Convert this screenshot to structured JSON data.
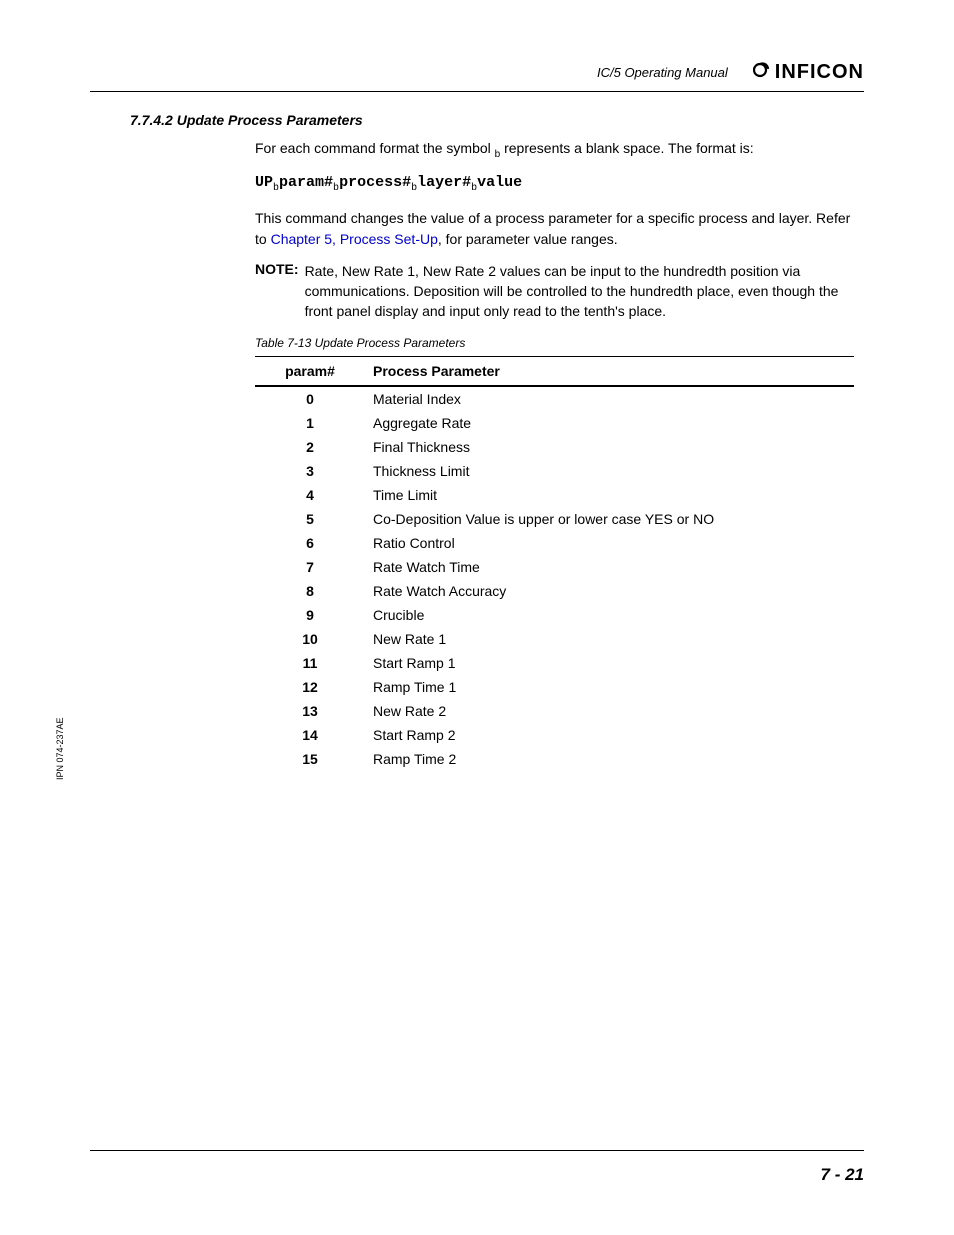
{
  "header": {
    "manual_title": "IC/5 Operating Manual",
    "logo_text": "INFICON"
  },
  "section": {
    "number_title": "7.7.4.2  Update Process Parameters"
  },
  "body": {
    "intro_line1": "For each command format the symbol ",
    "intro_sub": "b",
    "intro_line2": " represents a blank space. The format is:",
    "cmd": {
      "p1": "UP",
      "s1": "b",
      "p2": "param#",
      "s2": "b",
      "p3": "process#",
      "s3": "b",
      "p4": "layer#",
      "s4": "b",
      "p5": "value"
    },
    "desc_pre": "This command changes the value of a process parameter for a specific process and layer. Refer to ",
    "desc_link": "Chapter 5, Process Set-Up",
    "desc_post": ", for parameter value ranges.",
    "note_label": "NOTE:",
    "note_body": "Rate, New Rate 1, New Rate 2 values can be input to the hundredth position via communications. Deposition will be controlled to the hundredth place, even though the front panel display and input only read to the tenth's place."
  },
  "table": {
    "caption": "Table 7-13  Update Process Parameters",
    "col1": "param#",
    "col2": "Process Parameter",
    "rows": [
      {
        "n": "0",
        "p": "Material Index"
      },
      {
        "n": "1",
        "p": "Aggregate Rate"
      },
      {
        "n": "2",
        "p": "Final Thickness"
      },
      {
        "n": "3",
        "p": "Thickness Limit"
      },
      {
        "n": "4",
        "p": "Time Limit"
      },
      {
        "n": "5",
        "p": "Co-Deposition   Value is upper or lower case YES or NO"
      },
      {
        "n": "6",
        "p": "Ratio Control"
      },
      {
        "n": "7",
        "p": "Rate Watch Time"
      },
      {
        "n": "8",
        "p": "Rate Watch Accuracy"
      },
      {
        "n": "9",
        "p": "Crucible"
      },
      {
        "n": "10",
        "p": "New Rate 1"
      },
      {
        "n": "11",
        "p": "Start Ramp 1"
      },
      {
        "n": "12",
        "p": "Ramp Time 1"
      },
      {
        "n": "13",
        "p": "New Rate 2"
      },
      {
        "n": "14",
        "p": "Start Ramp 2"
      },
      {
        "n": "15",
        "p": "Ramp Time 2"
      }
    ]
  },
  "side": "IPN 074-237AE",
  "footer": {
    "page": "7 - 21"
  }
}
